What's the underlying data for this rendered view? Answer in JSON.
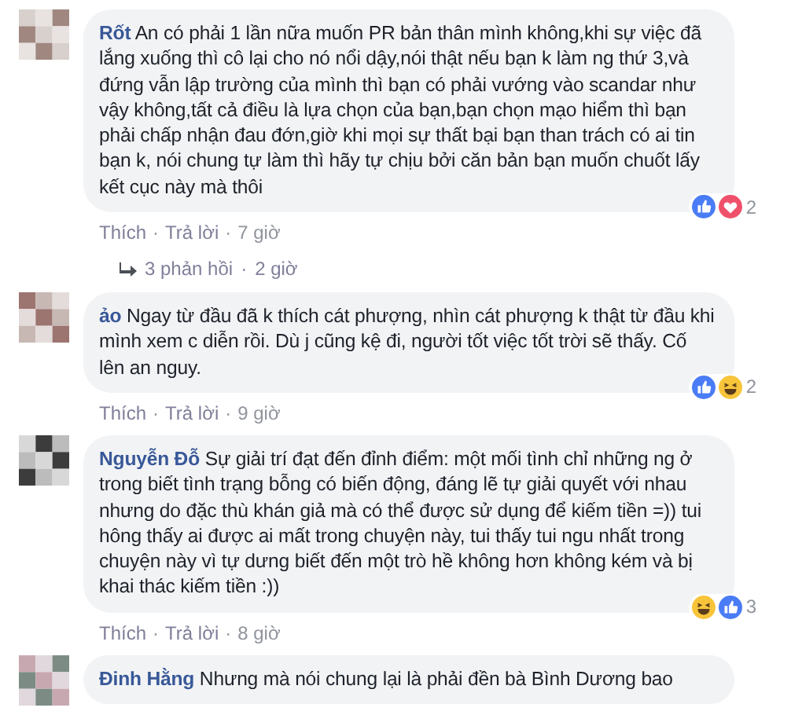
{
  "comments": [
    {
      "author": "Rốt",
      "text": "An có phải 1 lần nữa muốn PR bản thân mình không,khi sự việc đã lắng xuống thì cô lại cho nó nổi dậy,nói thật nếu bạn k làm ng thứ 3,và đứng vẫn lập trường của mình thì bạn có phải vướng vào scandar như vậy không,tất cả điều là lựa chọn của bạn,bạn chọn mạo hiểm thì bạn phải chấp nhận đau đớn,giờ khi mọi sự thất bại bạn than trách có ai tin bạn k, nói chung tự làm thì hãy tự chịu bởi căn bản bạn muốn chuốt lấy kết cục này mà thôi",
      "reactions": [
        {
          "kind": "like"
        },
        {
          "kind": "love"
        }
      ],
      "reaction_count": "2",
      "like": "Thích",
      "sep": "·",
      "reply": "Trả lời",
      "time": "7 giờ",
      "replies": "3 phản hồi",
      "replies_time": "2 giờ"
    },
    {
      "author": "ảo",
      "text": "Ngay từ đầu đã k thích cát phượng, nhìn cát phượng k thật từ đầu khi mình xem c diễn rồi. Dù j cũng kệ đi, người tốt việc tốt trời sẽ thấy. Cố lên an nguy.",
      "reactions": [
        {
          "kind": "like"
        },
        {
          "kind": "haha"
        }
      ],
      "reaction_count": "2",
      "like": "Thích",
      "sep": "·",
      "reply": "Trả lời",
      "time": "9 giờ"
    },
    {
      "author": "Nguyễn Đỗ",
      "text": "Sự giải trí đạt đến đỉnh điểm: một mối tình chỉ những ng ở trong biết tình trạng bỗng có biến động, đáng lẽ tự giải quyết với nhau nhưng do đặc thù khán giả mà có thể được sử dụng để kiếm tiền =)) tui hông thấy ai được ai mất trong chuyện này, tui thấy tui ngu nhất trong chuyện này vì tự dưng biết đến một trò hề không hơn không kém và bị khai thác kiếm tiền :))",
      "reactions": [
        {
          "kind": "haha"
        },
        {
          "kind": "like"
        }
      ],
      "reaction_count": "3",
      "like": "Thích",
      "sep": "·",
      "reply": "Trả lời",
      "time": "8 giờ"
    },
    {
      "author": "Đinh Hằng",
      "text": "Nhưng mà nói chung lại là phải đền bà Bình Dương bao"
    }
  ]
}
